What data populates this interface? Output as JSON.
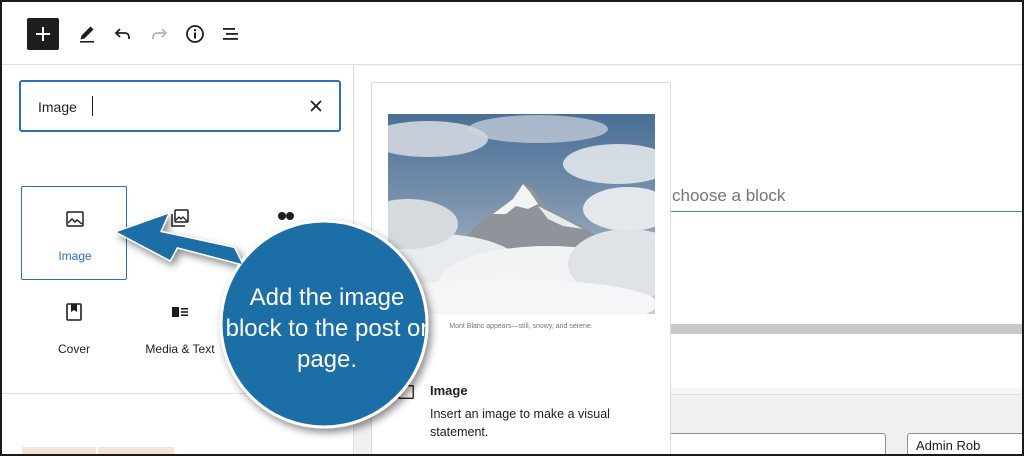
{
  "toolbar": {
    "buttons": [
      {
        "name": "add-block",
        "icon": "plus-icon"
      },
      {
        "name": "tools",
        "icon": "pencil-icon"
      },
      {
        "name": "undo",
        "icon": "undo-icon"
      },
      {
        "name": "redo",
        "icon": "redo-icon"
      },
      {
        "name": "details",
        "icon": "info-icon"
      },
      {
        "name": "list-view",
        "icon": "list-view-icon"
      }
    ]
  },
  "inserter": {
    "search": {
      "value": "Image"
    },
    "blocks": [
      {
        "label": "Image",
        "icon": "image-icon",
        "selected": true
      },
      {
        "label": "",
        "icon": "gallery-icon"
      },
      {
        "label": "",
        "icon": "dots-icon"
      },
      {
        "label": "Cover",
        "icon": "cover-icon"
      },
      {
        "label": "Media & Text",
        "icon": "media-text-icon"
      }
    ]
  },
  "editor": {
    "placeholder": "choose a block",
    "author_field": "Admin Rob"
  },
  "preview": {
    "caption": "Mont Blanc appears—still, snowy, and serene.",
    "block_title": "Image",
    "block_description": "Insert an image to make a visual statement."
  },
  "callout": {
    "text": "Add the image block to the post or page.",
    "color": "#1a6ea6"
  },
  "colors": {
    "accent": "#2e6fbd",
    "toolbar_button": "#1e1e1e"
  }
}
